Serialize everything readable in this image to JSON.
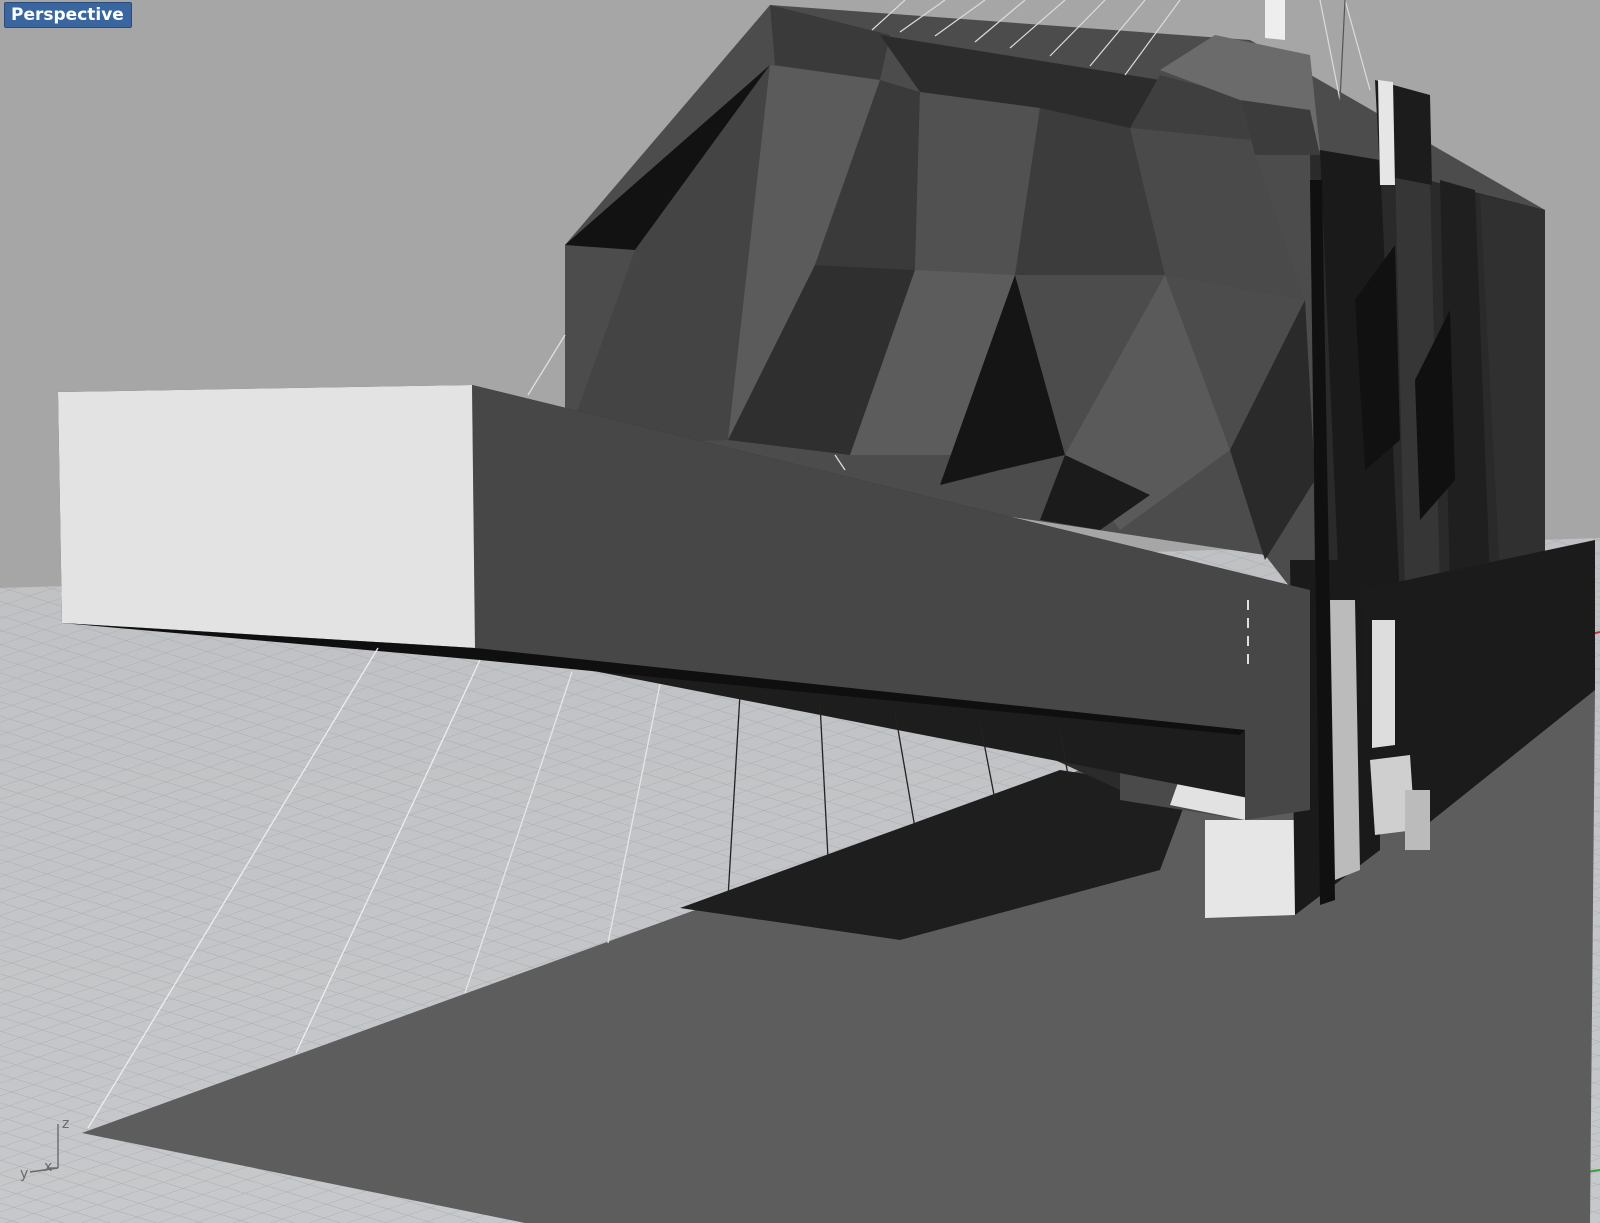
{
  "viewport": {
    "name": "Perspective"
  },
  "axis_widget": {
    "z_label": "z",
    "y_label": "y",
    "x_label": "x"
  },
  "colors": {
    "background": "#a6a6a6",
    "ground": "#c2c4c6",
    "grid_line": "#a2a6aa",
    "x_axis": "#c03434",
    "y_axis": "#3aa03a",
    "label_bg": "#3a66a0"
  }
}
